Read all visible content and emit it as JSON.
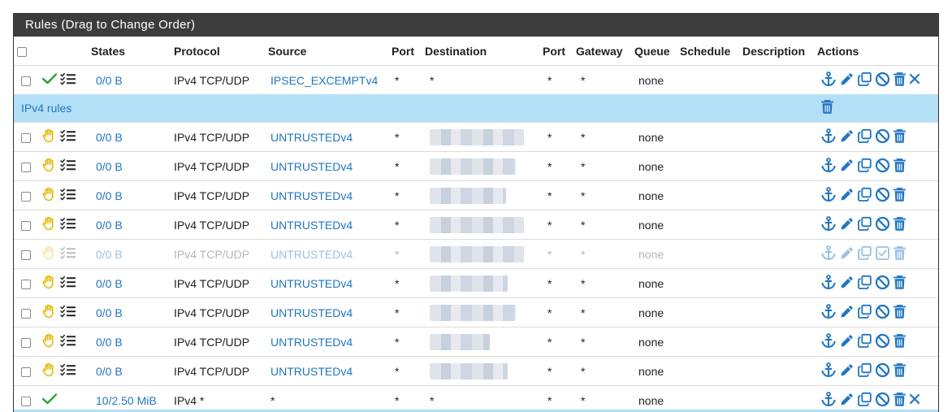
{
  "panel": {
    "title": "Rules (Drag to Change Order)"
  },
  "columns": {
    "states": "States",
    "protocol": "Protocol",
    "source": "Source",
    "port": "Port",
    "destination": "Destination",
    "port2": "Port",
    "gateway": "Gateway",
    "queue": "Queue",
    "schedule": "Schedule",
    "description": "Description",
    "actions": "Actions"
  },
  "section": {
    "label": "IPv4 rules"
  },
  "rows": [
    {
      "type": "pass",
      "states": "0/0 B",
      "protocol": "IPv4 TCP/UDP",
      "source": "IPSEC_EXCEMPTv4",
      "port": "*",
      "destination": "*",
      "dport": "*",
      "gateway": "*",
      "queue": "none",
      "enabled": true
    },
    {
      "type": "block",
      "states": "0/0 B",
      "protocol": "IPv4 TCP/UDP",
      "source": "UNTRUSTEDv4",
      "port": "*",
      "destination": "",
      "dport": "*",
      "gateway": "*",
      "queue": "none",
      "enabled": true
    },
    {
      "type": "block",
      "states": "0/0 B",
      "protocol": "IPv4 TCP/UDP",
      "source": "UNTRUSTEDv4",
      "port": "*",
      "destination": "",
      "dport": "*",
      "gateway": "*",
      "queue": "none",
      "enabled": true
    },
    {
      "type": "block",
      "states": "0/0 B",
      "protocol": "IPv4 TCP/UDP",
      "source": "UNTRUSTEDv4",
      "port": "*",
      "destination": "",
      "dport": "*",
      "gateway": "*",
      "queue": "none",
      "enabled": true
    },
    {
      "type": "block",
      "states": "0/0 B",
      "protocol": "IPv4 TCP/UDP",
      "source": "UNTRUSTEDv4",
      "port": "*",
      "destination": "",
      "dport": "*",
      "gateway": "*",
      "queue": "none",
      "enabled": true
    },
    {
      "type": "block",
      "states": "0/0 B",
      "protocol": "IPv4 TCP/UDP",
      "source": "UNTRUSTEDv4",
      "port": "*",
      "destination": "",
      "dport": "*",
      "gateway": "*",
      "queue": "none",
      "enabled": false
    },
    {
      "type": "block",
      "states": "0/0 B",
      "protocol": "IPv4 TCP/UDP",
      "source": "UNTRUSTEDv4",
      "port": "*",
      "destination": "",
      "dport": "*",
      "gateway": "*",
      "queue": "none",
      "enabled": true
    },
    {
      "type": "block",
      "states": "0/0 B",
      "protocol": "IPv4 TCP/UDP",
      "source": "UNTRUSTEDv4",
      "port": "*",
      "destination": "",
      "dport": "*",
      "gateway": "*",
      "queue": "none",
      "enabled": true
    },
    {
      "type": "block",
      "states": "0/0 B",
      "protocol": "IPv4 TCP/UDP",
      "source": "UNTRUSTEDv4",
      "port": "*",
      "destination": "",
      "dport": "*",
      "gateway": "*",
      "queue": "none",
      "enabled": true
    },
    {
      "type": "block",
      "states": "0/0 B",
      "protocol": "IPv4 TCP/UDP",
      "source": "UNTRUSTEDv4",
      "port": "*",
      "destination": "",
      "dport": "*",
      "gateway": "*",
      "queue": "none",
      "enabled": true
    },
    {
      "type": "pass",
      "states": "10/2.50 MiB",
      "protocol": "IPv4 *",
      "source": "*",
      "port": "*",
      "destination": "*",
      "dport": "*",
      "gateway": "*",
      "queue": "none",
      "enabled": true
    }
  ],
  "colors": {
    "link": "#2176c2",
    "section": "#b3e0f7",
    "pass": "#2e9e3e",
    "block": "#e8b700",
    "header": "#3c3c3c"
  },
  "icons": [
    "check-icon",
    "hand-icon",
    "list-icon",
    "anchor-icon",
    "pencil-icon",
    "copy-icon",
    "ban-icon",
    "trash-icon",
    "times-icon",
    "checkbox-enable-icon"
  ]
}
